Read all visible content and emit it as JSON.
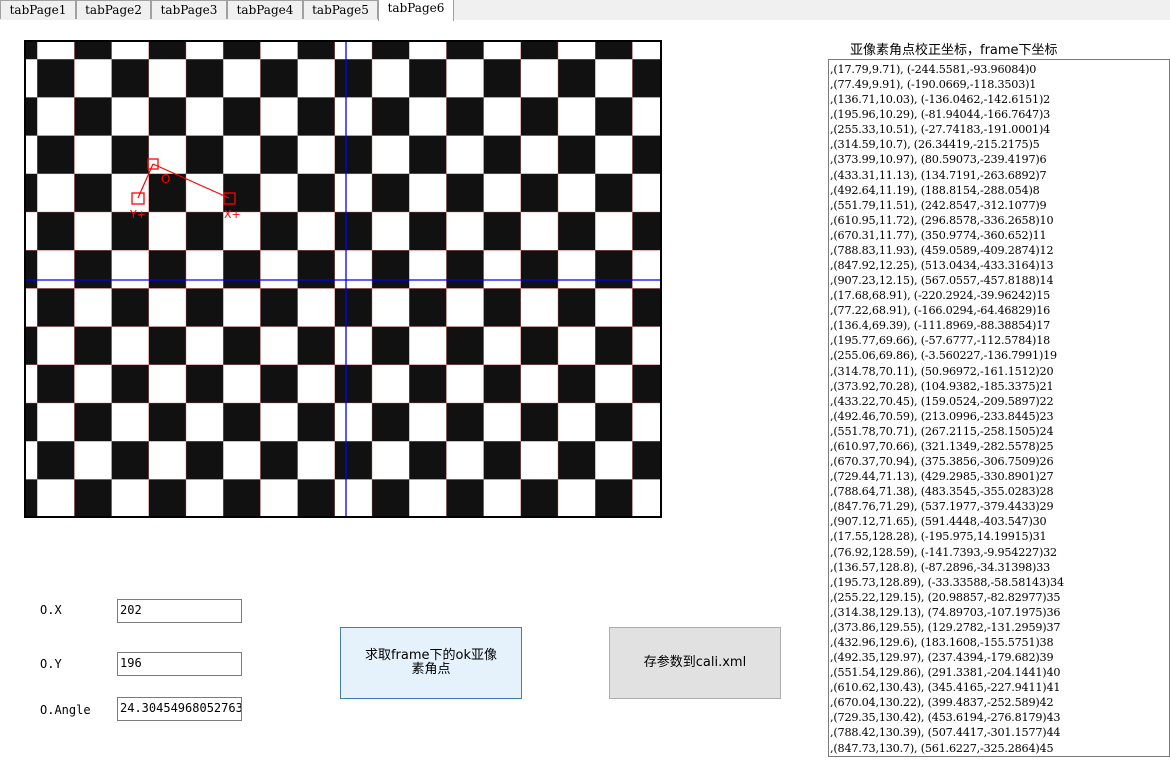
{
  "tabs": [
    "tabPage1",
    "tabPage2",
    "tabPage3",
    "tabPage4",
    "tabPage5",
    "tabPage6"
  ],
  "active_tab": "tabPage6",
  "image_overlay": {
    "origin_label": "O",
    "x_axis_label": "X+",
    "y_axis_label": "Y+",
    "line_color": "#ff0000",
    "crosshair_color": "#0000ff"
  },
  "fields": {
    "ox_label": "O.X",
    "ox_value": "202",
    "oy_label": "O.Y",
    "oy_value": "196",
    "angle_label": "O.Angle",
    "angle_value": "24.30454968052763"
  },
  "buttons": {
    "compute": "求取frame下的ok亚像素角点",
    "save": "存参数到cali.xml"
  },
  "list": {
    "title": "亚像素角点校正坐标，frame下坐标",
    "items": [
      ",(17.79,9.71), (-244.5581,-93.96084)0",
      ",(77.49,9.91), (-190.0669,-118.3503)1",
      ",(136.71,10.03), (-136.0462,-142.6151)2",
      ",(195.96,10.29), (-81.94044,-166.7647)3",
      ",(255.33,10.51), (-27.74183,-191.0001)4",
      ",(314.59,10.7), (26.34419,-215.2175)5",
      ",(373.99,10.97), (80.59073,-239.4197)6",
      ",(433.31,11.13), (134.7191,-263.6892)7",
      ",(492.64,11.19), (188.8154,-288.054)8",
      ",(551.79,11.51), (242.8547,-312.1077)9",
      ",(610.95,11.72), (296.8578,-336.2658)10",
      ",(670.31,11.77), (350.9774,-360.652)11",
      ",(788.83,11.93), (459.0589,-409.2874)12",
      ",(847.92,12.25), (513.0434,-433.3164)13",
      ",(907.23,12.15), (567.0557,-457.8188)14",
      ",(17.68,68.91), (-220.2924,-39.96242)15",
      ",(77.22,68.91), (-166.0294,-64.46829)16",
      ",(136.4,69.39), (-111.8969,-88.38854)17",
      ",(195.77,69.66), (-57.6777,-112.5784)18",
      ",(255.06,69.86), (-3.560227,-136.7991)19",
      ",(314.78,70.11), (50.96972,-161.1512)20",
      ",(373.92,70.28), (104.9382,-185.3375)21",
      ",(433.22,70.45), (159.0524,-209.5897)22",
      ",(492.46,70.59), (213.0996,-233.8445)23",
      ",(551.78,70.71), (267.2115,-258.1505)24",
      ",(610.97,70.66), (321.1349,-282.5578)25",
      ",(670.37,70.94), (375.3856,-306.7509)26",
      ",(729.44,71.13), (429.2985,-330.8901)27",
      ",(788.64,71.38), (483.3545,-355.0283)28",
      ",(847.76,71.29), (537.1977,-379.4433)29",
      ",(907.12,71.65), (591.4448,-403.547)30",
      ",(17.55,128.28), (-195.975,14.19915)31",
      ",(76.92,128.59), (-141.7393,-9.954227)32",
      ",(136.57,128.8), (-87.2896,-34.31398)33",
      ",(195.73,128.89), (-33.33588,-58.58143)34",
      ",(255.22,129.15), (20.98857,-82.82977)35",
      ",(314.38,129.13), (74.89703,-107.1975)36",
      ",(373.86,129.55), (129.2782,-131.2959)37",
      ",(432.96,129.6), (183.1608,-155.5751)38",
      ",(492.35,129.97), (237.4394,-179.682)39",
      ",(551.54,129.86), (291.3381,-204.1441)40",
      ",(610.62,130.43), (345.4165,-227.9411)41",
      ",(670.04,130.22), (399.4837,-252.589)42",
      ",(729.35,130.42), (453.6194,-276.8179)43",
      ",(788.42,130.39), (507.4417,-301.1577)44",
      ",(847.73,130.7), (561.6227,-325.2864)45"
    ]
  }
}
